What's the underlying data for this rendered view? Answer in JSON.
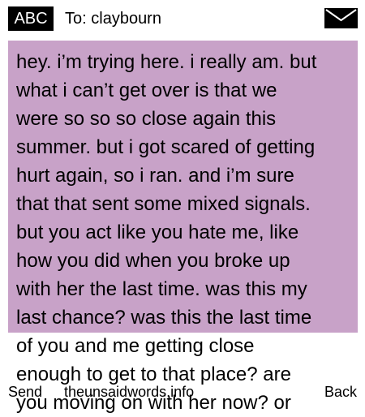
{
  "header": {
    "mode_label": "ABC",
    "to_label": "To:",
    "recipient": "claybourn",
    "icon": "envelope-icon"
  },
  "message": {
    "lines": [
      "hey. i’m trying here. i really am. but",
      "what i can’t get over is that we",
      "were so so so close again this",
      "summer. but i got scared of getting",
      "hurt again, so i ran. and i’m sure",
      "that that sent some mixed signals.",
      "but you act like you hate me, like",
      "how you did when you broke up",
      "with her the last time. was this my",
      "last chance? was this the last time",
      "of you and me getting close",
      "enough to get to that place? are",
      "you moving on with her now? or"
    ]
  },
  "footer": {
    "send_label": "Send",
    "site_label": "theunsaidwords.info",
    "back_label": "Back"
  },
  "colors": {
    "message_background": "#c8a2c8",
    "badge_background": "#000000"
  }
}
